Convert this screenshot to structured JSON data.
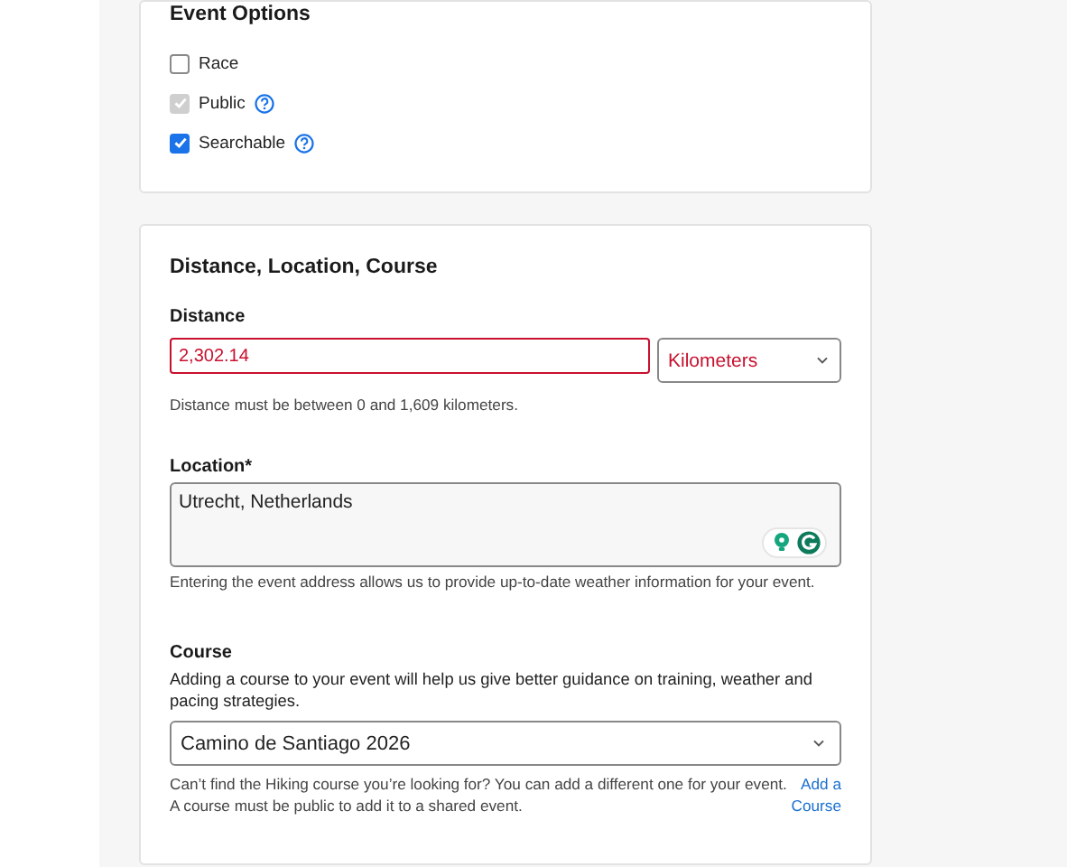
{
  "event_options": {
    "title": "Event Options",
    "options": [
      {
        "label": "Race",
        "checked": false,
        "disabled": false,
        "help": false
      },
      {
        "label": "Public",
        "checked": true,
        "disabled": true,
        "help": true
      },
      {
        "label": "Searchable",
        "checked": true,
        "disabled": false,
        "help": true
      }
    ]
  },
  "distance_section": {
    "title": "Distance, Location, Course",
    "distance": {
      "label": "Distance",
      "value": "2,302.14",
      "invalid": true,
      "unit": "Kilometers",
      "hint": "Distance must be between 0 and 1,609 kilometers."
    },
    "location": {
      "label": "Location*",
      "value": "Utrecht, Netherlands",
      "hint": "Entering the event address allows us to provide up-to-date weather information for your event."
    },
    "course": {
      "label": "Course",
      "description": "Adding a course to your event will help us give better guidance on training, weather and pacing strategies.",
      "value": "Camino de Santiago 2026",
      "hint_lines": [
        "Can’t find the Hiking course you’re looking for? You can add a different one for your event.",
        "A course must be public to add it to a shared event."
      ],
      "link": "Add a Course"
    }
  }
}
